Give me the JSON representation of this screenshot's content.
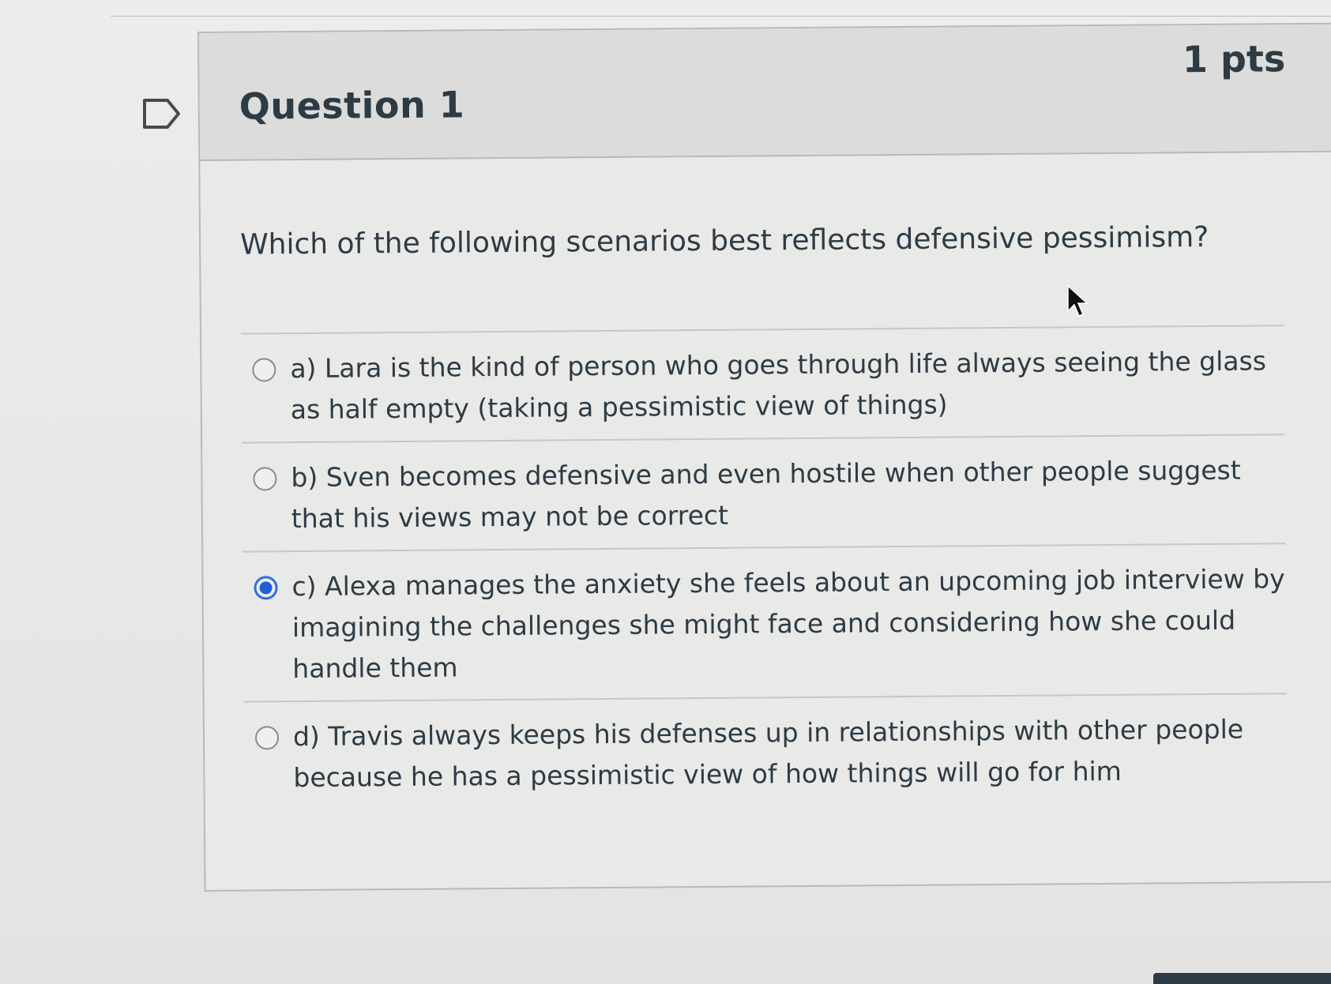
{
  "question": {
    "title": "Question 1",
    "points": "1 pts",
    "text": "Which of the following scenarios best reflects defensive pessimism?"
  },
  "answers": [
    {
      "label": "a) Lara is the kind of person who goes through life always seeing the glass as half empty (taking a pessimistic view of things)",
      "selected": false
    },
    {
      "label": "b) Sven becomes defensive and even hostile when other people suggest that his views may not be correct",
      "selected": false
    },
    {
      "label": "c) Alexa manages the anxiety she feels about an upcoming job interview by imagining the challenges she might face and considering how she could handle them",
      "selected": true
    },
    {
      "label": "d) Travis always keeps his defenses up in relationships with other people because he has a pessimistic view of how things will go for him",
      "selected": false
    }
  ],
  "icons": {
    "flag": "flag-outline-icon",
    "cursor": "mouse-pointer-icon"
  },
  "colors": {
    "text": "#2d3b45",
    "radio_selected": "#1f5fd6",
    "header_bg": "#dcdcda",
    "border": "#b9b9b7"
  }
}
